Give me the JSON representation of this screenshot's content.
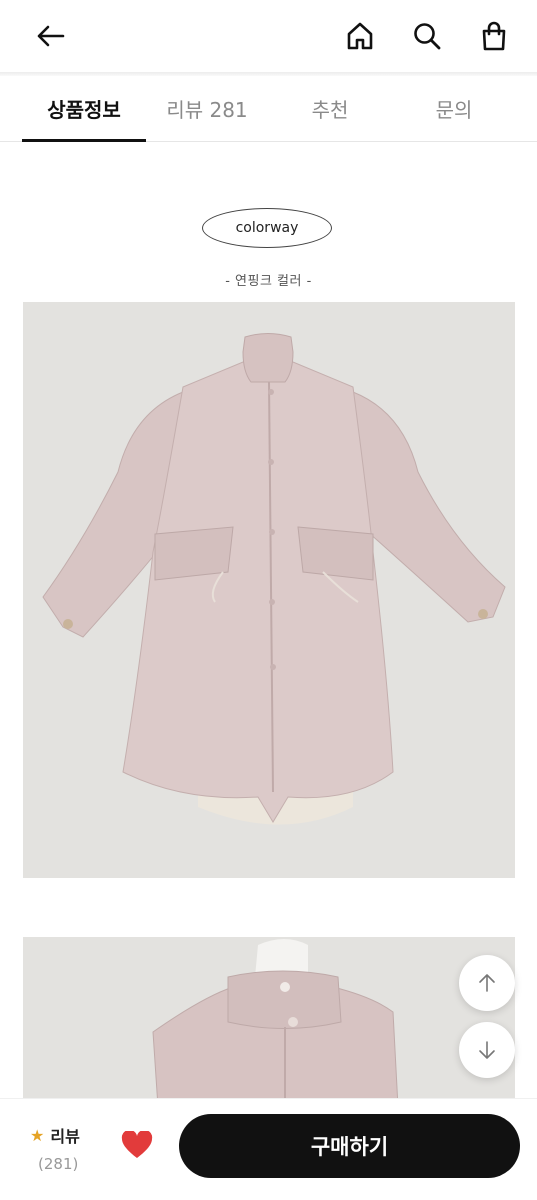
{
  "header": {
    "icons": [
      "arrow-left-icon",
      "home-icon",
      "search-icon",
      "shopping-bag-icon"
    ]
  },
  "tabs": [
    {
      "label": "상품정보",
      "active": true
    },
    {
      "label": "리뷰 281",
      "active": false
    },
    {
      "label": "추천",
      "active": false
    },
    {
      "label": "문의",
      "active": false
    }
  ],
  "content": {
    "colorway_label": "colorway",
    "color_caption": "- 연핑크 컬러 -"
  },
  "scroll_buttons": [
    "arrow-up-icon",
    "arrow-down-icon"
  ],
  "bottom_bar": {
    "review_label": "리뷰",
    "review_count": "(281)",
    "wishlist_icon": "heart-icon",
    "buy_label": "구매하기"
  },
  "colors": {
    "accent_star": "#e5a325",
    "heart": "#e23b3b",
    "buy_button": "#111111",
    "photo_background": "#e3e2df",
    "coat": "#d9c6c6"
  }
}
